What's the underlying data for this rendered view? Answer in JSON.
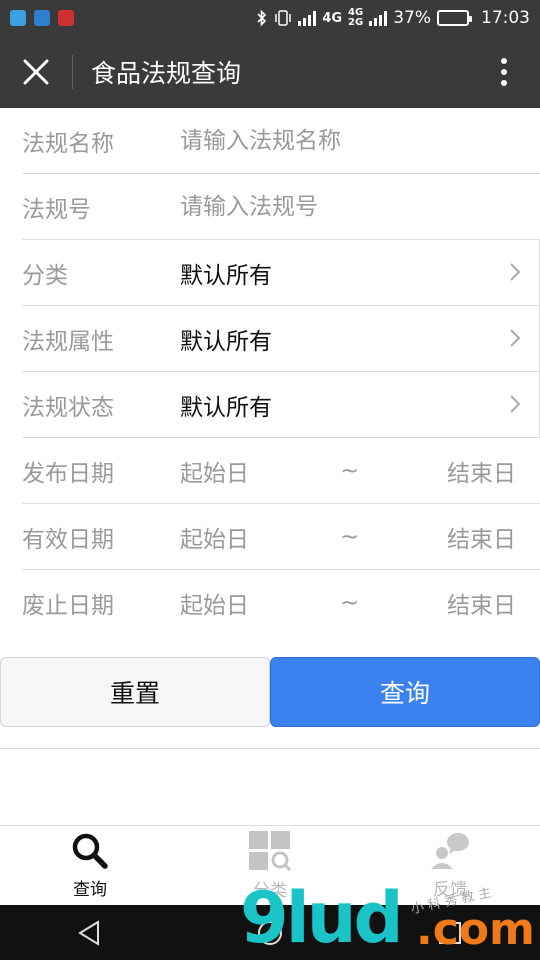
{
  "status_bar": {
    "network": "4G",
    "network2": "4G",
    "network2_sub": "2G",
    "battery": "37%",
    "battery_level": 0.37,
    "time": "17:03"
  },
  "header": {
    "title": "食品法规查询"
  },
  "form": {
    "name": {
      "label": "法规名称",
      "placeholder": "请输入法规名称"
    },
    "number": {
      "label": "法规号",
      "placeholder": "请输入法规号"
    },
    "category": {
      "label": "分类",
      "value": "默认所有"
    },
    "attribute": {
      "label": "法规属性",
      "value": "默认所有"
    },
    "state": {
      "label": "法规状态",
      "value": "默认所有"
    },
    "publish_date": {
      "label": "发布日期",
      "start": "起始日",
      "sep": "~",
      "end": "结束日"
    },
    "effective_date": {
      "label": "有效日期",
      "start": "起始日",
      "sep": "~",
      "end": "结束日"
    },
    "repeal_date": {
      "label": "废止日期",
      "start": "起始日",
      "sep": "~",
      "end": "结束日"
    }
  },
  "buttons": {
    "reset": "重置",
    "query": "查询"
  },
  "bottom_nav": {
    "items": [
      {
        "label": "查询",
        "icon": "search-icon"
      },
      {
        "label": "分类",
        "icon": "category-icon"
      },
      {
        "label": "反馈",
        "icon": "feedback-icon"
      }
    ]
  },
  "watermark": {
    "main": "9lud",
    "suffix": ".com",
    "small": "小 科 秀 教 主"
  },
  "colors": {
    "header_bg": "#3a3a3a",
    "accent": "#3b82f0",
    "label_gray": "#9a9a9a"
  }
}
